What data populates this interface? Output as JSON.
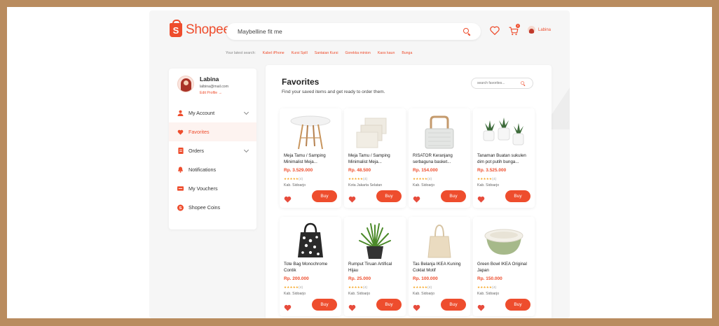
{
  "header": {
    "logo_text": "Shopee",
    "search_value": "Maybelline fit me",
    "latest_label": "Your latest search:",
    "latest_searches": [
      "Kabel iPhone",
      "Kursi Spill",
      "Santaian Kursi",
      "Gorekka minion",
      "Kaos kaun",
      "Bunga"
    ],
    "cart_count": "0",
    "username": "Labina"
  },
  "sidebar": {
    "name": "Labina",
    "email": "lalbina@mail.com",
    "edit": "Edit Profile →",
    "items": [
      {
        "label": "My Account",
        "icon": "user-icon"
      },
      {
        "label": "Favorites",
        "icon": "heart-icon"
      },
      {
        "label": "Orders",
        "icon": "clipboard-icon"
      },
      {
        "label": "Notifications",
        "icon": "bell-icon"
      },
      {
        "label": "My Vouchers",
        "icon": "voucher-icon"
      },
      {
        "label": "Shopee Coins",
        "icon": "coin-icon"
      }
    ]
  },
  "main": {
    "title": "Favorites",
    "subtitle": "Find your saved items and get ready to order them.",
    "search_placeholder": "search favorites..."
  },
  "products": [
    {
      "name": "Meja Tamu / Samping Minimalist Meja...",
      "price": "Rp. 3.529.000",
      "stars": "★★★★★",
      "count": "(4)",
      "location": "Kab. Sidoarjo",
      "buy": "Buy",
      "image": "table-icon"
    },
    {
      "name": "Meja Tamu / Samping Minimalist Meja...",
      "price": "Rp. 48.500",
      "stars": "★★★★★",
      "count": "(4)",
      "location": "Kota Jakarta Selatan",
      "buy": "Buy",
      "image": "coaster-icon"
    },
    {
      "name": "RISATOR Keranjang serbaguna basket...",
      "price": "Rp. 154.000",
      "stars": "★★★★★",
      "count": "(4)",
      "location": "Kab. Sidoarjo",
      "buy": "Buy",
      "image": "basket-icon"
    },
    {
      "name": "Tanaman Buatan sukulen dim pot putih bunga...",
      "price": "Rp. 3.525.000",
      "stars": "★★★★★",
      "count": "(4)",
      "location": "Kab. Sidoarjo",
      "buy": "Buy",
      "image": "succulent-icon"
    },
    {
      "name": "Tote Bag Monochrome Contik",
      "price": "Rp. 200.000",
      "stars": "★★★★★",
      "count": "(4)",
      "location": "Kab. Sidoarjo",
      "buy": "Buy",
      "image": "tote-bag-icon"
    },
    {
      "name": "Rumput Tiruan Artifical Hijau",
      "price": "Rp. 25.000",
      "stars": "★★★★★",
      "count": "(4)",
      "location": "Kab. Sidoarjo",
      "buy": "Buy",
      "image": "grass-icon"
    },
    {
      "name": "Tas Belanja IKEA Kuning Coklat Motif",
      "price": "Rp. 100.000",
      "stars": "★★★★★",
      "count": "(4)",
      "location": "Kab. Sidoarjo",
      "buy": "Buy",
      "image": "canvas-bag-icon"
    },
    {
      "name": "Green Bowl IKEA Original Japan",
      "price": "Rp. 150.000",
      "stars": "★★★★★",
      "count": "(4)",
      "location": "Kab. Sidoarjo",
      "buy": "Buy",
      "image": "bowl-icon"
    }
  ],
  "colors": {
    "accent": "#ee4d2d",
    "frame": "#b98c5f",
    "active_bg": "#fdf3f0",
    "star": "#f5a623"
  }
}
